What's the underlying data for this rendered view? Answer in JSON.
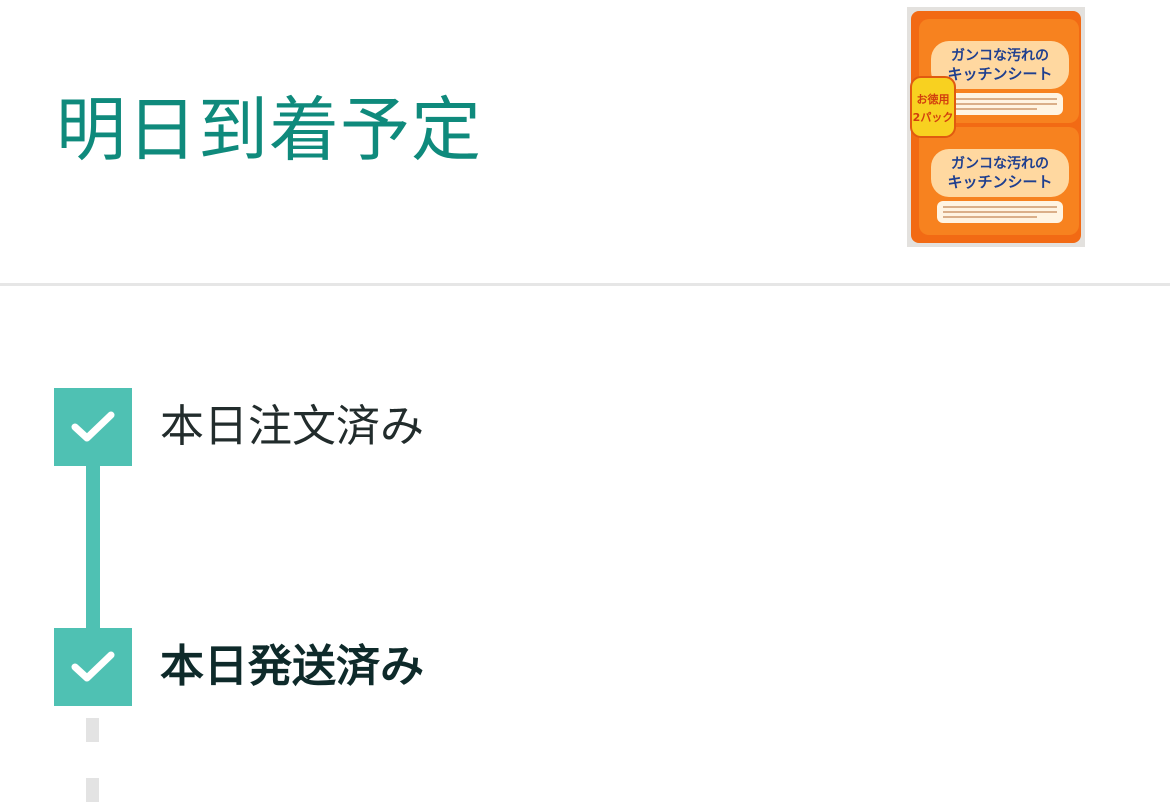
{
  "header": {
    "delivery_status": "明日到着予定",
    "product_image": {
      "alt": "キッチンシート 2パック",
      "package_text": {
        "headline_1": "ガンコな汚れの",
        "headline_2": "キッチンシート",
        "badge": "お徳用 2パック"
      },
      "colors": {
        "orange": "#f47a1f",
        "background": "#e3e1de",
        "text_blue": "#1f3f8f"
      }
    }
  },
  "timeline": {
    "colors": {
      "done": "#4fc1b3",
      "pending": "#e3e3e3",
      "title": "#0f8a7c"
    },
    "steps": [
      {
        "label": "本日注文済み",
        "done": true,
        "current": false,
        "icon": "check-icon"
      },
      {
        "label": "本日発送済み",
        "done": true,
        "current": true,
        "icon": "check-icon"
      }
    ]
  }
}
